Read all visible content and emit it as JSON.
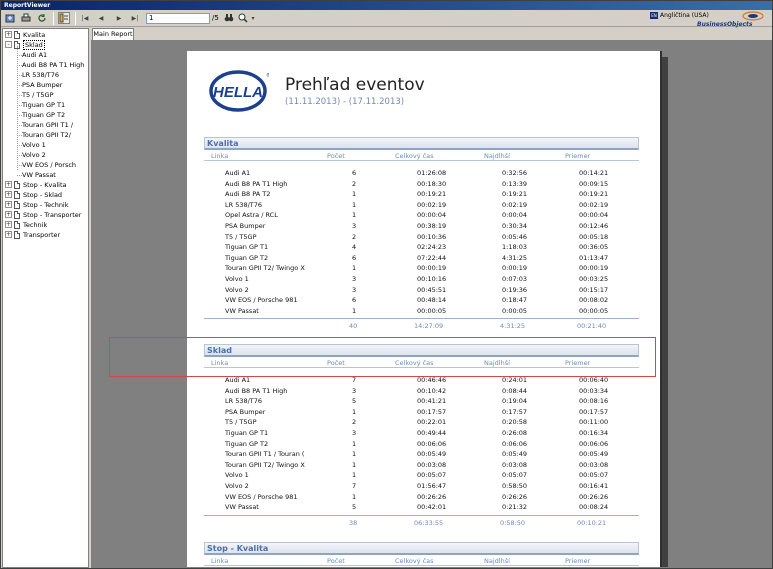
{
  "window": {
    "title": "ReportViewer"
  },
  "toolbar": {
    "page_value": "1",
    "page_total": "/5",
    "language": "Angličtina (USA)",
    "language_code": "EN",
    "brand": "BusinessObjects"
  },
  "tree": {
    "items": [
      {
        "label": "Kvalita",
        "level": 0,
        "expander": "+"
      },
      {
        "label": "Sklad",
        "level": 0,
        "expander": "-",
        "selected": true
      },
      {
        "label": "Audi A1",
        "level": 1
      },
      {
        "label": "Audi B8 PA T1 High",
        "level": 1
      },
      {
        "label": "LR 538/T76",
        "level": 1
      },
      {
        "label": "PSA Bumper",
        "level": 1
      },
      {
        "label": "T5 / T5GP",
        "level": 1
      },
      {
        "label": "Tiguan GP T1",
        "level": 1
      },
      {
        "label": "Tiguan GP T2",
        "level": 1
      },
      {
        "label": "Touran GPII T1 /",
        "level": 1
      },
      {
        "label": "Touran GPII T2/",
        "level": 1
      },
      {
        "label": "Volvo 1",
        "level": 1
      },
      {
        "label": "Volvo 2",
        "level": 1
      },
      {
        "label": "VW EOS / Porsch",
        "level": 1
      },
      {
        "label": "VW Passat",
        "level": 1
      },
      {
        "label": "Stop - Kvalita",
        "level": 0,
        "expander": "+"
      },
      {
        "label": "Stop - Sklad",
        "level": 0,
        "expander": "+"
      },
      {
        "label": "Stop - Technik",
        "level": 0,
        "expander": "+"
      },
      {
        "label": "Stop - Transporter",
        "level": 0,
        "expander": "+"
      },
      {
        "label": "Technik",
        "level": 0,
        "expander": "+"
      },
      {
        "label": "Transporter",
        "level": 0,
        "expander": "+"
      }
    ]
  },
  "tabs": {
    "main_report": "Main Report"
  },
  "report": {
    "logo_text": "HELLA",
    "title": "Prehľad eventov",
    "dates": "(11.11.2013) - (17.11.2013)",
    "columns": {
      "linka": "Linka",
      "pocet": "Počet",
      "celkovy_cas": "Celkový čas",
      "najdlhsi": "Najdlhší",
      "priemer": "Priemer"
    },
    "sections": [
      {
        "title": "Kvalita",
        "rows": [
          [
            "Audi A1",
            "6",
            "01:26:08",
            "0:32:56",
            "00:14:21"
          ],
          [
            "Audi B8 PA T1 High",
            "2",
            "00:18:30",
            "0:13:39",
            "00:09:15"
          ],
          [
            "Audi B8 PA T2",
            "1",
            "00:19:21",
            "0:19:21",
            "00:19:21"
          ],
          [
            "LR 538/T76",
            "1",
            "00:02:19",
            "0:02:19",
            "00:02:19"
          ],
          [
            "Opel Astra / RCL",
            "1",
            "00:00:04",
            "0:00:04",
            "00:00:04"
          ],
          [
            "PSA Bumper",
            "3",
            "00:38:19",
            "0:30:34",
            "00:12:46"
          ],
          [
            "T5 / T5GP",
            "2",
            "00:10:36",
            "0:05:46",
            "00:05:18"
          ],
          [
            "Tiguan GP T1",
            "4",
            "02:24:23",
            "1:18:03",
            "00:36:05"
          ],
          [
            "Tiguan GP T2",
            "6",
            "07:22:44",
            "4:31:25",
            "01:13:47"
          ],
          [
            "Touran GPII T2/ Twingo X",
            "1",
            "00:00:19",
            "0:00:19",
            "00:00:19"
          ],
          [
            "Volvo 1",
            "3",
            "00:10:16",
            "0:07:03",
            "00:03:25"
          ],
          [
            "Volvo 2",
            "3",
            "00:45:51",
            "0:19:36",
            "00:15:17"
          ],
          [
            "VW EOS / Porsche 981",
            "6",
            "00:48:14",
            "0:18:47",
            "00:08:02"
          ],
          [
            "VW Passat",
            "1",
            "00:00:05",
            "0:00:05",
            "00:00:05"
          ]
        ],
        "total": [
          "",
          "40",
          "14:27:09",
          "4:31:25",
          "00:21:40"
        ]
      },
      {
        "title": "Sklad",
        "rows": [
          [
            "Audi A1",
            "7",
            "00:46:46",
            "0:24:01",
            "00:06:40"
          ],
          [
            "Audi B8 PA T1 High",
            "3",
            "00:10:42",
            "0:08:44",
            "00:03:34"
          ],
          [
            "LR 538/T76",
            "5",
            "00:41:21",
            "0:19:04",
            "00:08:16"
          ],
          [
            "PSA Bumper",
            "1",
            "00:17:57",
            "0:17:57",
            "00:17:57"
          ],
          [
            "T5 / T5GP",
            "2",
            "00:22:01",
            "0:20:58",
            "00:11:00"
          ],
          [
            "Tiguan GP T1",
            "3",
            "00:49:44",
            "0:26:08",
            "00:16:34"
          ],
          [
            "Tiguan GP T2",
            "1",
            "00:06:06",
            "0:06:06",
            "00:06:06"
          ],
          [
            "Touran GPII T1 / Touran (",
            "1",
            "00:05:49",
            "0:05:49",
            "00:05:49"
          ],
          [
            "Touran GPII T2/ Twingo X",
            "1",
            "00:03:08",
            "0:03:08",
            "00:03:08"
          ],
          [
            "Volvo 1",
            "1",
            "00:05:07",
            "0:05:07",
            "00:05:07"
          ],
          [
            "Volvo 2",
            "7",
            "01:56:47",
            "0:58:50",
            "00:16:41"
          ],
          [
            "VW EOS / Porsche 981",
            "1",
            "00:26:26",
            "0:26:26",
            "00:26:26"
          ],
          [
            "VW Passat",
            "5",
            "00:42:01",
            "0:21:32",
            "00:08:24"
          ]
        ],
        "total": [
          "",
          "38",
          "06:33:55",
          "0:58:50",
          "00:10:21"
        ]
      },
      {
        "title": "Stop - Kvalita",
        "rows": [],
        "total": null
      }
    ]
  }
}
